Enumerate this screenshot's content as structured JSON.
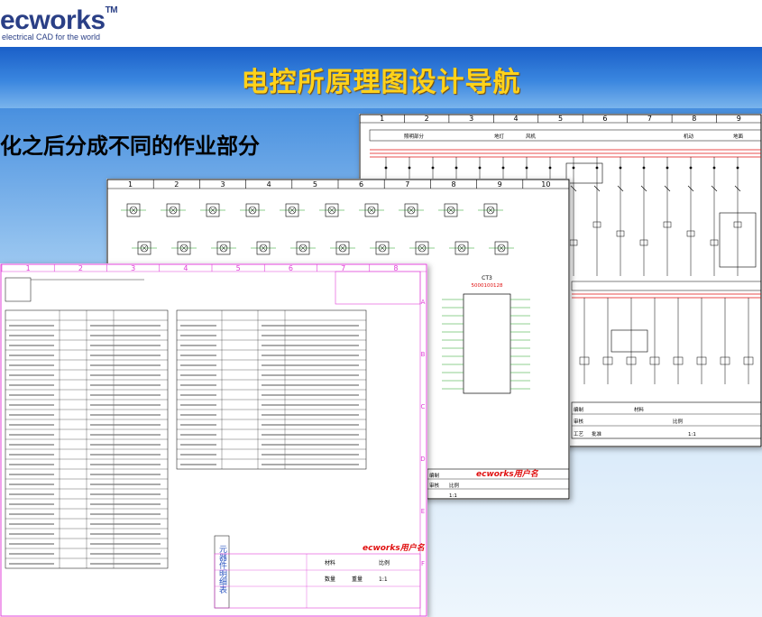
{
  "brand": {
    "logo_prefix": "ec",
    "logo_suffix": "works",
    "logo_tm": "TM",
    "tagline": "electrical CAD for the world"
  },
  "banner": {
    "title": "电控所原理图设计导航"
  },
  "slide": {
    "subtitle": "化之后分成不同的作业部分"
  },
  "sheets": {
    "back": {
      "columns": [
        "1",
        "2",
        "3",
        "4",
        "5",
        "6",
        "7",
        "8",
        "9"
      ],
      "header_cells": [
        "照明部分",
        "地灯",
        "风机",
        "",
        "机动",
        "地面"
      ],
      "title_block": [
        "编制",
        "审核",
        "工艺",
        "批准",
        "材料",
        "比例",
        "1:1"
      ]
    },
    "mid": {
      "columns": [
        "1",
        "2",
        "3",
        "4",
        "5",
        "6",
        "7",
        "8",
        "9",
        "10"
      ],
      "box_label": "CT3",
      "box_sub": "5000100128",
      "title_block": [
        "编制",
        "审核",
        "比例",
        "1:1"
      ],
      "stamp": "ecworks用户名"
    },
    "front": {
      "columns": [
        "1",
        "2",
        "3",
        "4",
        "5",
        "6",
        "7",
        "8"
      ],
      "rows": [
        "A",
        "B",
        "C",
        "D",
        "E",
        "F"
      ],
      "title_block": [
        "材料",
        "比例",
        "1:1",
        "数量",
        "重量"
      ],
      "side_labels": [
        "元器件明细表"
      ],
      "stamp": "ecworks用户名"
    }
  },
  "colors": {
    "banner_title": "#ffd21a",
    "accent_blue": "#1f6bd1",
    "sheet_border_pink": "#e040d8",
    "circuit_red": "#e01010"
  }
}
